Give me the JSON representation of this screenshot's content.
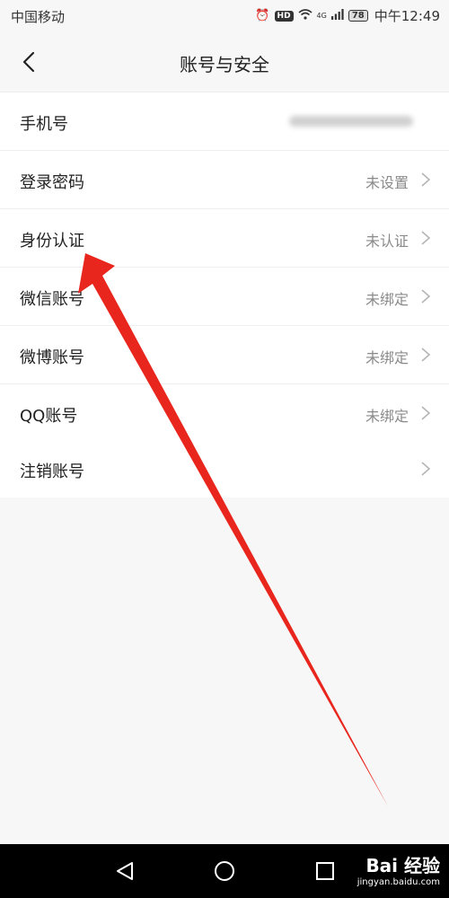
{
  "status_bar": {
    "carrier": "中国移动",
    "hd": "HD",
    "network": "4G",
    "battery": "78",
    "time": "中午12:49"
  },
  "header": {
    "title": "账号与安全",
    "back_icon": "chevron-left-icon"
  },
  "settings": {
    "items": [
      {
        "label": "手机号",
        "value": ""
      },
      {
        "label": "登录密码",
        "value": "未设置"
      },
      {
        "label": "身份认证",
        "value": "未认证"
      },
      {
        "label": "微信账号",
        "value": "未绑定"
      },
      {
        "label": "微博账号",
        "value": "未绑定"
      },
      {
        "label": "QQ账号",
        "value": "未绑定"
      }
    ],
    "deactivate": {
      "label": "注销账号"
    }
  },
  "annotation": {
    "arrow_color": "#e8261d"
  },
  "watermark": {
    "main": "Bai 经验",
    "sub": "jingyan.baidu.com"
  }
}
